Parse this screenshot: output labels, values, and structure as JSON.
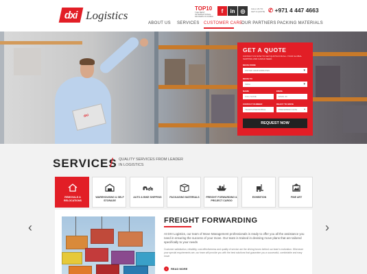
{
  "header": {
    "logo_mark": "dxi",
    "logo_text": "Logistics",
    "award_title": "TOP10",
    "award_caption": "THE BEST INTERNATIONAL MOVERS IN DUBAI",
    "social": [
      "f",
      "in",
      "◎"
    ],
    "call_caption": "CALL US TO GET A QUOTE",
    "phone": "+971 4 447 4663",
    "nav": [
      "ABOUT US",
      "SERVICES",
      "CUSTOMER CARE",
      "OUR PARTNERS",
      "PACKING MATERIALS"
    ],
    "active_nav": "CUSTOMER CARE",
    "accent_color": "#e21e26"
  },
  "quote": {
    "title": "GET A QUOTE",
    "subtitle": "CONTACT US NOW TO GET QUOTE FOR ALL YOUR GLOBAL SHIPPING AND CARGO NEED.",
    "move_from_label": "MOVE FROM",
    "move_from_value": "UNITED ARAB EMIRATES",
    "move_to_label": "MOVE TO",
    "move_to_value": "INDIA",
    "name_label": "NAME",
    "name_placeholder": "FULL NAME",
    "email_label": "EMAIL",
    "email_placeholder": "EMAIL ID",
    "contact_label": "CONTACT NUMBER",
    "contact_placeholder": "TELEPHONE/MOBILE",
    "ready_label": "READY TO MOVE",
    "ready_placeholder": "PREFERRED DATE",
    "button": "REQUEST NOW"
  },
  "services": {
    "title": "SERVICES",
    "subtitle": "QUALITY SERVICES FROM LEADER IN LOGISTICS",
    "tiles": [
      {
        "label": "REMOVALS & RELOCATIONS",
        "icon": "house-icon",
        "active": true
      },
      {
        "label": "WAREHOUSING & SELF STORAGE",
        "icon": "warehouse-icon",
        "active": false
      },
      {
        "label": "AUTO & BIKE SHIPPING",
        "icon": "car-bike-icon",
        "active": false
      },
      {
        "label": "PACKAGING MATERIALS",
        "icon": "box-icon",
        "active": false
      },
      {
        "label": "FREIGHT FORWARDING & PROJECT CARGO",
        "icon": "ship-icon",
        "active": false
      },
      {
        "label": "EXHIBITION",
        "icon": "forklift-icon",
        "active": false
      },
      {
        "label": "FINE ART",
        "icon": "frame-icon",
        "active": false
      }
    ],
    "prev_arrow": "‹",
    "next_arrow": "›"
  },
  "feature": {
    "title": "FREIGHT FORWARDING",
    "para1": "At DXI Logistics, our team of Move Management professionals is ready to offer you all the assistance you need in ensuring the success of your move. Our team is trained in devising move plans that are tailored specifically to your needs",
    "para2": "Customer satisfaction, reliability, cost-effectiveness and quality of service are the driving forces behind our team's motivation. Whenever your special requirements are, our team will provide you with the best solutions that guarantee you a successful, comfortable and easy move",
    "read_more": "READ MORE"
  }
}
